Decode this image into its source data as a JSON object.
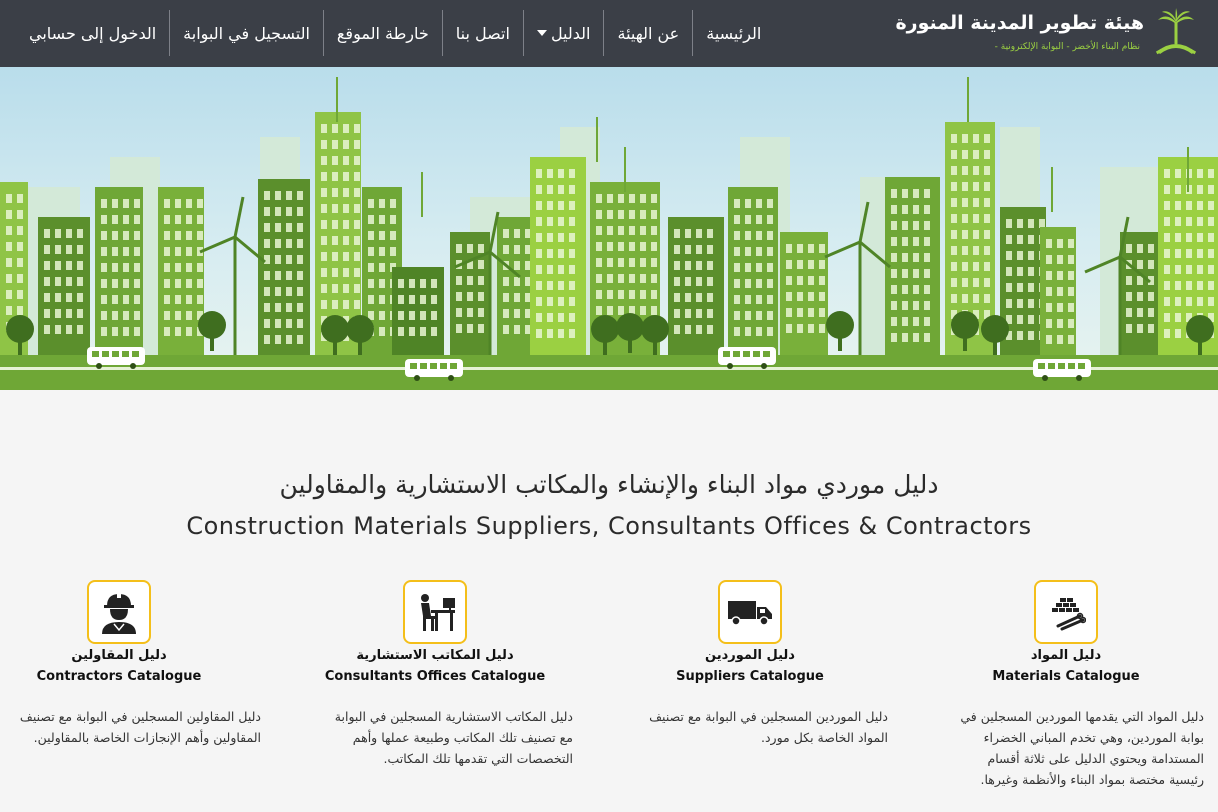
{
  "header": {
    "brand_title": "هيئة تطوير المدينة المنورة",
    "brand_subtitle": "نظام البناء الأخضر - البوابة الإلكترونية -",
    "nav": [
      {
        "label": "الدخول إلى حسابي"
      },
      {
        "label": "التسجيل في البوابة"
      },
      {
        "label": "خارطة الموقع"
      },
      {
        "label": "اتصل بنا"
      },
      {
        "label": "الدليل"
      },
      {
        "label": "عن الهيئة"
      },
      {
        "label": "الرئيسية"
      }
    ]
  },
  "main": {
    "heading_ar": "دليل موردي مواد البناء والإنشاء والمكاتب الاستشارية والمقاولين",
    "heading_en": "Construction Materials Suppliers, Consultants Offices & Contractors"
  },
  "cards": {
    "materials": {
      "icon": "bricks-pipes-icon",
      "title_ar": "دليل المواد",
      "title_en": "Materials Catalogue",
      "desc_lines": [
        "دليل المواد التي يقدمها الموردين المسجلين في",
        "بوابة الموردين، وهي تخدم المباني الخضراء",
        "المستدامة ويحتوي الدليل على ثلاثة أقسام",
        "رئيسية مختصة بمواد البناء والأنظمة وغيرها."
      ]
    },
    "suppliers": {
      "icon": "truck-icon",
      "title_ar": "دليل الموردين",
      "title_en": "Suppliers Catalogue",
      "desc_lines": [
        "دليل الموردين المسجلين في البوابة مع تصنيف",
        "المواد الخاصة بكل مورد."
      ]
    },
    "consultants": {
      "icon": "office-desk-icon",
      "title_ar": "دليل المكاتب الاستشارية",
      "title_en": "Consultants Offices Catalogue",
      "desc_lines": [
        "دليل المكاتب الاستشارية المسجلين في البوابة",
        "مع تصنيف تلك المكاتب وطبيعة عملها وأهم",
        "التخصصات التي تقدمها تلك المكاتب."
      ]
    },
    "contractors": {
      "icon": "construction-worker-icon",
      "title_ar": "دليل المقاولين",
      "title_en": "Contractors Catalogue",
      "desc_lines": [
        "دليل المقاولين المسجلين في البوابة مع تصنيف",
        "المقاولين وأهم الإنجازات الخاصة بالمقاولين."
      ]
    }
  },
  "colors": {
    "header_bg": "#3b3f47",
    "accent_green": "#9bd042",
    "icon_border": "#f4bf1a"
  }
}
